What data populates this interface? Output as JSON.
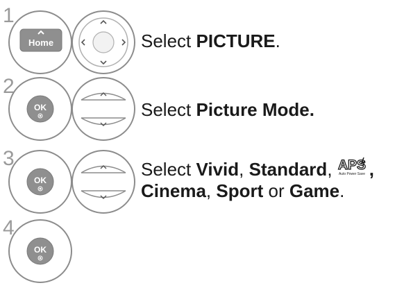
{
  "steps": [
    {
      "number": "1",
      "button_label": "Home",
      "text_pre": "Select ",
      "text_bold": "PICTURE",
      "text_post": "."
    },
    {
      "number": "2",
      "button_label": "OK",
      "text_pre": "Select ",
      "text_bold": "Picture Mode."
    },
    {
      "number": "3",
      "button_label": "OK",
      "text_pre": "Select ",
      "mode_vivid": "Vivid",
      "sep_1": ", ",
      "mode_standard": "Standard",
      "sep_2": ", ",
      "aps_logo": "APS",
      "aps_sub": "Auto Power Save",
      "sep_3": ",",
      "mode_cinema": "Cinema",
      "sep_4": ", ",
      "mode_sport": "Sport",
      "sep_5": " or ",
      "mode_game": "Game",
      "text_end": "."
    },
    {
      "number": "4",
      "button_label": "OK"
    }
  ],
  "icons": {
    "home_button": "home-icon",
    "nav_pad": "nav-pad-icon",
    "up_down": "up-down-icon",
    "ok_button": "ok-icon"
  }
}
